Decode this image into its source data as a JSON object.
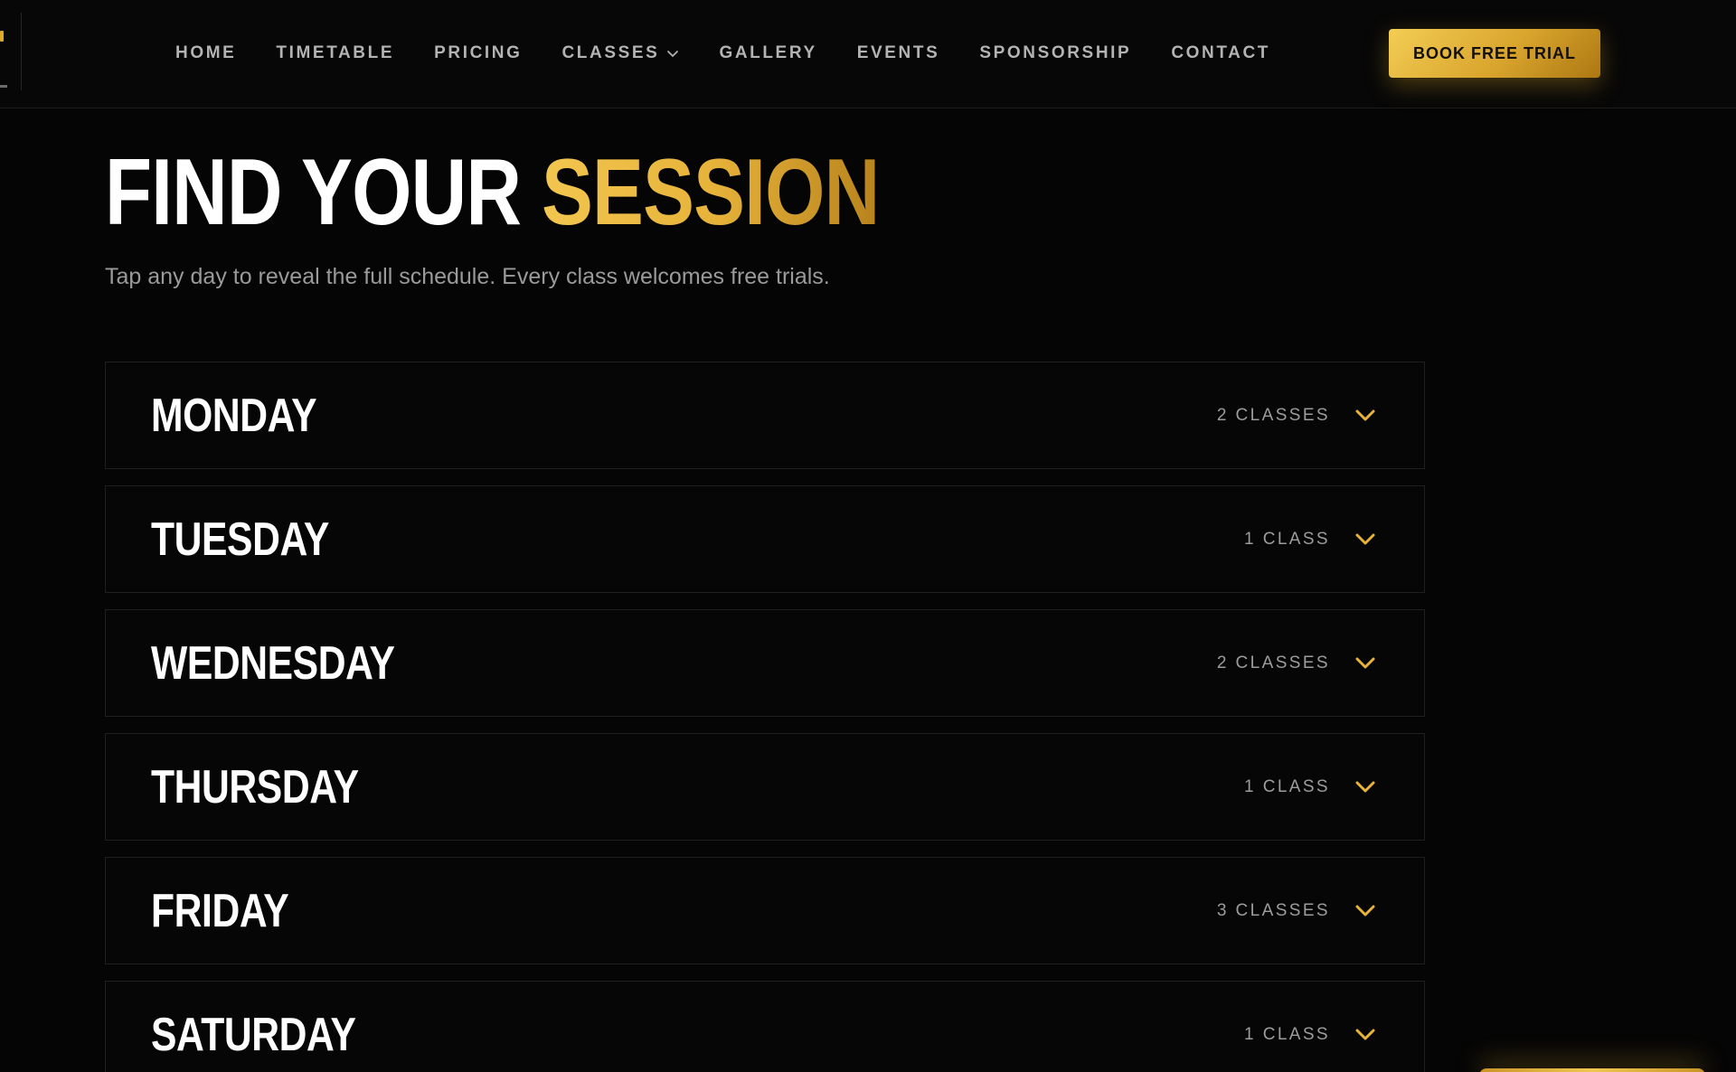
{
  "nav": {
    "items": [
      {
        "label": "HOME",
        "has_dropdown": false
      },
      {
        "label": "TIMETABLE",
        "has_dropdown": false
      },
      {
        "label": "PRICING",
        "has_dropdown": false
      },
      {
        "label": "CLASSES",
        "has_dropdown": true
      },
      {
        "label": "GALLERY",
        "has_dropdown": false
      },
      {
        "label": "EVENTS",
        "has_dropdown": false
      },
      {
        "label": "SPONSORSHIP",
        "has_dropdown": false
      },
      {
        "label": "CONTACT",
        "has_dropdown": false
      }
    ],
    "cta_label": "BOOK FREE TRIAL"
  },
  "hero": {
    "title_plain": "FIND YOUR ",
    "title_accent": "SESSION",
    "subtitle": "Tap any day to reveal the full schedule. Every class welcomes free trials."
  },
  "days": [
    {
      "name": "MONDAY",
      "count": "2 CLASSES"
    },
    {
      "name": "TUESDAY",
      "count": "1 CLASS"
    },
    {
      "name": "WEDNESDAY",
      "count": "2 CLASSES"
    },
    {
      "name": "THURSDAY",
      "count": "1 CLASS"
    },
    {
      "name": "FRIDAY",
      "count": "3 CLASSES"
    },
    {
      "name": "SATURDAY",
      "count": "1 CLASS"
    }
  ],
  "colors": {
    "background": "#050505",
    "accent_gold": "#e8b33a",
    "nav_text": "#b3b3b3",
    "muted_text": "#9a9a9a",
    "border": "#1f1f1f"
  },
  "icons": {
    "nav_dropdown": "chevron-down-icon",
    "day_expand": "chevron-down-icon"
  }
}
